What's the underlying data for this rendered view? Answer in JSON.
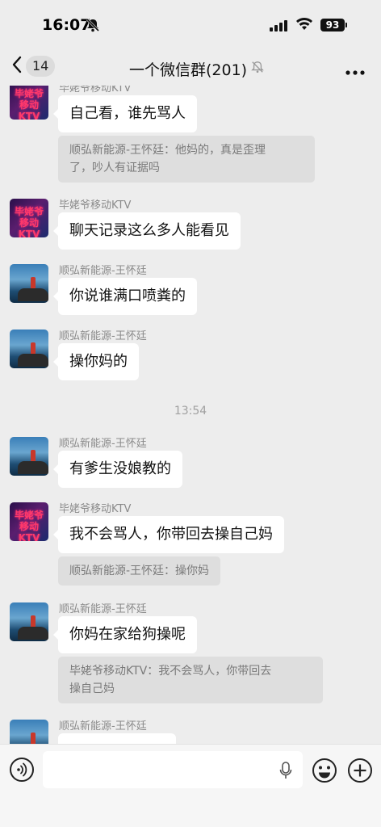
{
  "status_bar": {
    "time": "16:07",
    "battery": "93"
  },
  "nav": {
    "back_count": "14",
    "title": "一个微信群(201)"
  },
  "time_divider": "13:54",
  "messages": [
    {
      "sender": "毕姥爷移动KTV",
      "text": "自己看，谁先骂人",
      "quote": [
        "顺弘新能源-王怀廷：他妈的，真是歪理",
        "了，吵人有证据吗"
      ]
    },
    {
      "sender": "毕姥爷移动KTV",
      "text": "聊天记录这么多人能看见"
    },
    {
      "sender": "顺弘新能源-王怀廷",
      "text": "你说谁满口喷粪的"
    },
    {
      "sender": "顺弘新能源-王怀廷",
      "text": "操你妈的"
    },
    {
      "sender": "顺弘新能源-王怀廷",
      "text": "有爹生没娘教的"
    },
    {
      "sender": "毕姥爷移动KTV",
      "text": "我不会骂人，你带回去操自己妈",
      "quote": [
        "顺弘新能源-王怀廷：操你妈"
      ]
    },
    {
      "sender": "顺弘新能源-王怀廷",
      "text": "你妈在家给狗操呢",
      "quote": [
        "毕姥爷移动KTV：我不会骂人，你带回去",
        "操自己妈"
      ]
    },
    {
      "sender": "顺弘新能源-王怀廷"
    }
  ],
  "avatars": {
    "ktv_text": [
      "毕姥爷",
      "移动KTV"
    ]
  },
  "icons": {
    "mute": "bell-slash-icon",
    "back": "chevron-left-icon",
    "more": "ellipsis-icon",
    "voice": "voice-icon",
    "mic": "microphone-icon",
    "emoji": "emoji-icon",
    "plus": "plus-circle-icon"
  }
}
